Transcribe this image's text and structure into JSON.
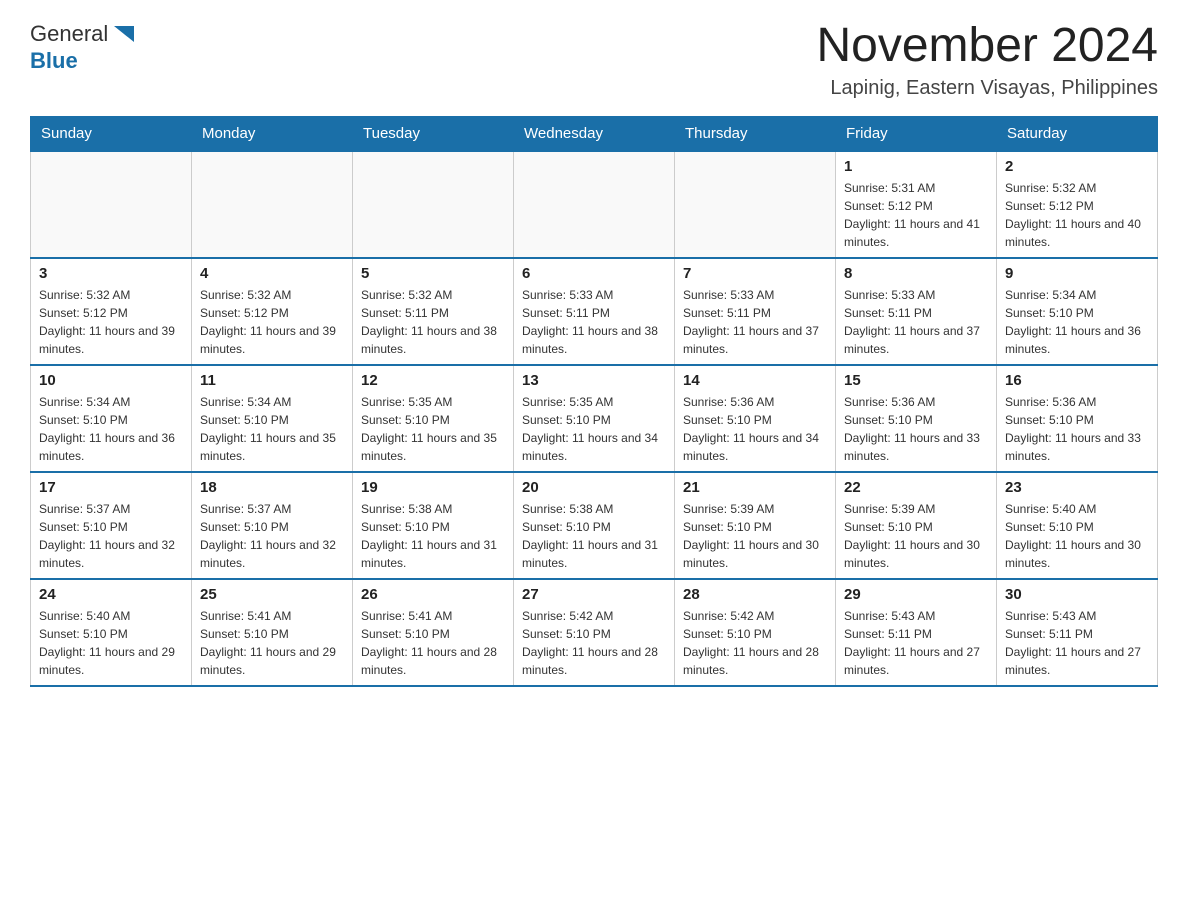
{
  "header": {
    "logo_text_general": "General",
    "logo_text_blue": "Blue",
    "main_title": "November 2024",
    "subtitle": "Lapinig, Eastern Visayas, Philippines"
  },
  "calendar": {
    "days_of_week": [
      "Sunday",
      "Monday",
      "Tuesday",
      "Wednesday",
      "Thursday",
      "Friday",
      "Saturday"
    ],
    "weeks": [
      [
        {
          "day": "",
          "info": ""
        },
        {
          "day": "",
          "info": ""
        },
        {
          "day": "",
          "info": ""
        },
        {
          "day": "",
          "info": ""
        },
        {
          "day": "",
          "info": ""
        },
        {
          "day": "1",
          "info": "Sunrise: 5:31 AM\nSunset: 5:12 PM\nDaylight: 11 hours and 41 minutes."
        },
        {
          "day": "2",
          "info": "Sunrise: 5:32 AM\nSunset: 5:12 PM\nDaylight: 11 hours and 40 minutes."
        }
      ],
      [
        {
          "day": "3",
          "info": "Sunrise: 5:32 AM\nSunset: 5:12 PM\nDaylight: 11 hours and 39 minutes."
        },
        {
          "day": "4",
          "info": "Sunrise: 5:32 AM\nSunset: 5:12 PM\nDaylight: 11 hours and 39 minutes."
        },
        {
          "day": "5",
          "info": "Sunrise: 5:32 AM\nSunset: 5:11 PM\nDaylight: 11 hours and 38 minutes."
        },
        {
          "day": "6",
          "info": "Sunrise: 5:33 AM\nSunset: 5:11 PM\nDaylight: 11 hours and 38 minutes."
        },
        {
          "day": "7",
          "info": "Sunrise: 5:33 AM\nSunset: 5:11 PM\nDaylight: 11 hours and 37 minutes."
        },
        {
          "day": "8",
          "info": "Sunrise: 5:33 AM\nSunset: 5:11 PM\nDaylight: 11 hours and 37 minutes."
        },
        {
          "day": "9",
          "info": "Sunrise: 5:34 AM\nSunset: 5:10 PM\nDaylight: 11 hours and 36 minutes."
        }
      ],
      [
        {
          "day": "10",
          "info": "Sunrise: 5:34 AM\nSunset: 5:10 PM\nDaylight: 11 hours and 36 minutes."
        },
        {
          "day": "11",
          "info": "Sunrise: 5:34 AM\nSunset: 5:10 PM\nDaylight: 11 hours and 35 minutes."
        },
        {
          "day": "12",
          "info": "Sunrise: 5:35 AM\nSunset: 5:10 PM\nDaylight: 11 hours and 35 minutes."
        },
        {
          "day": "13",
          "info": "Sunrise: 5:35 AM\nSunset: 5:10 PM\nDaylight: 11 hours and 34 minutes."
        },
        {
          "day": "14",
          "info": "Sunrise: 5:36 AM\nSunset: 5:10 PM\nDaylight: 11 hours and 34 minutes."
        },
        {
          "day": "15",
          "info": "Sunrise: 5:36 AM\nSunset: 5:10 PM\nDaylight: 11 hours and 33 minutes."
        },
        {
          "day": "16",
          "info": "Sunrise: 5:36 AM\nSunset: 5:10 PM\nDaylight: 11 hours and 33 minutes."
        }
      ],
      [
        {
          "day": "17",
          "info": "Sunrise: 5:37 AM\nSunset: 5:10 PM\nDaylight: 11 hours and 32 minutes."
        },
        {
          "day": "18",
          "info": "Sunrise: 5:37 AM\nSunset: 5:10 PM\nDaylight: 11 hours and 32 minutes."
        },
        {
          "day": "19",
          "info": "Sunrise: 5:38 AM\nSunset: 5:10 PM\nDaylight: 11 hours and 31 minutes."
        },
        {
          "day": "20",
          "info": "Sunrise: 5:38 AM\nSunset: 5:10 PM\nDaylight: 11 hours and 31 minutes."
        },
        {
          "day": "21",
          "info": "Sunrise: 5:39 AM\nSunset: 5:10 PM\nDaylight: 11 hours and 30 minutes."
        },
        {
          "day": "22",
          "info": "Sunrise: 5:39 AM\nSunset: 5:10 PM\nDaylight: 11 hours and 30 minutes."
        },
        {
          "day": "23",
          "info": "Sunrise: 5:40 AM\nSunset: 5:10 PM\nDaylight: 11 hours and 30 minutes."
        }
      ],
      [
        {
          "day": "24",
          "info": "Sunrise: 5:40 AM\nSunset: 5:10 PM\nDaylight: 11 hours and 29 minutes."
        },
        {
          "day": "25",
          "info": "Sunrise: 5:41 AM\nSunset: 5:10 PM\nDaylight: 11 hours and 29 minutes."
        },
        {
          "day": "26",
          "info": "Sunrise: 5:41 AM\nSunset: 5:10 PM\nDaylight: 11 hours and 28 minutes."
        },
        {
          "day": "27",
          "info": "Sunrise: 5:42 AM\nSunset: 5:10 PM\nDaylight: 11 hours and 28 minutes."
        },
        {
          "day": "28",
          "info": "Sunrise: 5:42 AM\nSunset: 5:10 PM\nDaylight: 11 hours and 28 minutes."
        },
        {
          "day": "29",
          "info": "Sunrise: 5:43 AM\nSunset: 5:11 PM\nDaylight: 11 hours and 27 minutes."
        },
        {
          "day": "30",
          "info": "Sunrise: 5:43 AM\nSunset: 5:11 PM\nDaylight: 11 hours and 27 minutes."
        }
      ]
    ]
  }
}
